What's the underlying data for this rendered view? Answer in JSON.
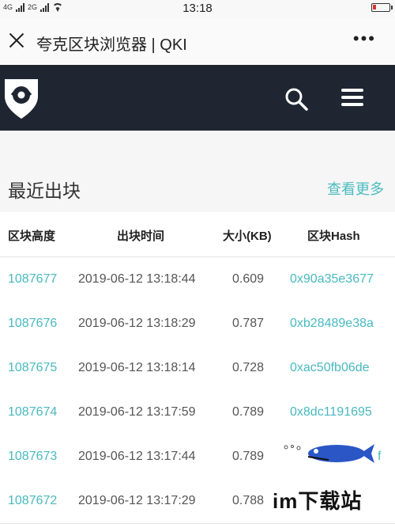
{
  "status_bar": {
    "network": [
      "4G",
      "2G"
    ],
    "time": "13:18"
  },
  "title_bar": {
    "title": "夸克区块浏览器 | QKI"
  },
  "section": {
    "title": "最近出块",
    "more_link": "查看更多"
  },
  "table": {
    "headers": [
      "区块高度",
      "出块时间",
      "大小(KB)",
      "区块Hash"
    ],
    "rows": [
      {
        "height": "1087677",
        "time": "2019-06-12 13:18:44",
        "size": "0.609",
        "hash": "0x90a35e3677"
      },
      {
        "height": "1087676",
        "time": "2019-06-12 13:18:29",
        "size": "0.787",
        "hash": "0xb28489e38a"
      },
      {
        "height": "1087675",
        "time": "2019-06-12 13:18:14",
        "size": "0.728",
        "hash": "0xac50fb06de"
      },
      {
        "height": "1087674",
        "time": "2019-06-12 13:17:59",
        "size": "0.789",
        "hash": "0x8dc1191695"
      },
      {
        "height": "1087673",
        "time": "2019-06-12 13:17:44",
        "size": "0.789",
        "hash": "f"
      },
      {
        "height": "1087672",
        "time": "2019-06-12 13:17:29",
        "size": "0.788",
        "hash": ""
      }
    ]
  },
  "watermark": {
    "text": "im下载站"
  },
  "colors": {
    "header_bg": "#1f2632",
    "accent": "#49b9c0"
  }
}
